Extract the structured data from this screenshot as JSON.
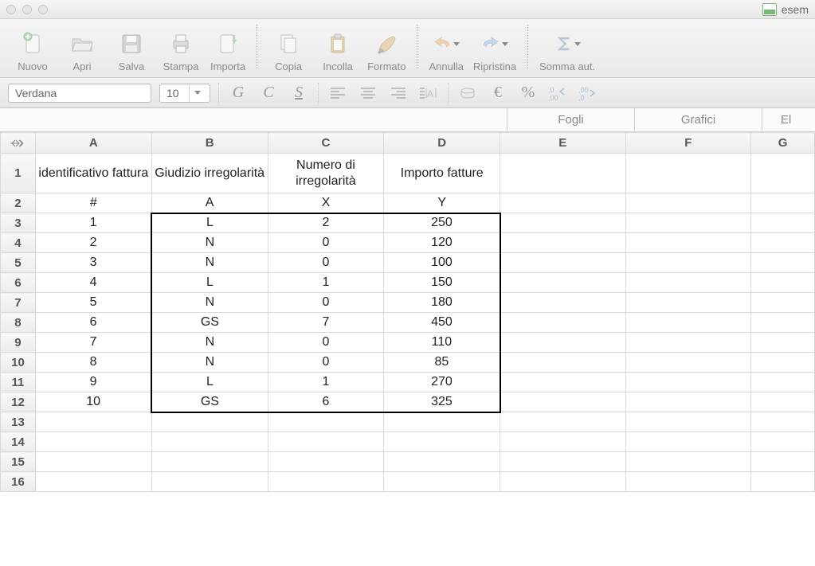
{
  "window": {
    "title": "esem"
  },
  "toolbar": {
    "nuovo": "Nuovo",
    "apri": "Apri",
    "salva": "Salva",
    "stampa": "Stampa",
    "importa": "Importa",
    "copia": "Copia",
    "incolla": "Incolla",
    "formato": "Formato",
    "annulla": "Annulla",
    "ripristina": "Ripristina",
    "somma": "Somma aut."
  },
  "formatbar": {
    "font_name": "Verdana",
    "font_size": "10",
    "bold": "G",
    "italic": "C",
    "underline": "S",
    "euro": "€",
    "percent": "%"
  },
  "tabs": {
    "fogli": "Fogli",
    "grafici": "Grafici",
    "el": "El"
  },
  "columns": [
    "A",
    "B",
    "C",
    "D",
    "E",
    "F",
    "G"
  ],
  "chart_data": {
    "type": "table",
    "headers": {
      "A": "identificativo fattura",
      "B": "Giudizio irregolarità",
      "C": "Numero di irregolarità",
      "D": "Importo fatture"
    },
    "symbols": {
      "A": "#",
      "B": "A",
      "C": "X",
      "D": "Y"
    },
    "rows": [
      {
        "id": 1,
        "giudizio": "L",
        "numero": 2,
        "importo": 250
      },
      {
        "id": 2,
        "giudizio": "N",
        "numero": 0,
        "importo": 120
      },
      {
        "id": 3,
        "giudizio": "N",
        "numero": 0,
        "importo": 100
      },
      {
        "id": 4,
        "giudizio": "L",
        "numero": 1,
        "importo": 150
      },
      {
        "id": 5,
        "giudizio": "N",
        "numero": 0,
        "importo": 180
      },
      {
        "id": 6,
        "giudizio": "GS",
        "numero": 7,
        "importo": 450
      },
      {
        "id": 7,
        "giudizio": "N",
        "numero": 0,
        "importo": 110
      },
      {
        "id": 8,
        "giudizio": "N",
        "numero": 0,
        "importo": 85
      },
      {
        "id": 9,
        "giudizio": "L",
        "numero": 1,
        "importo": 270
      },
      {
        "id": 10,
        "giudizio": "GS",
        "numero": 6,
        "importo": 325
      }
    ]
  }
}
